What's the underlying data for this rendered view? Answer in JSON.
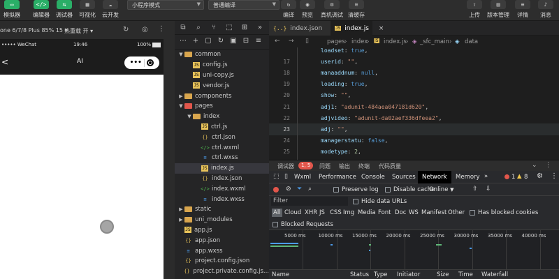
{
  "toolbar": {
    "buttons": [
      {
        "label": "模拟器",
        "glyph": "▭"
      },
      {
        "label": "编辑器",
        "glyph": "</>"
      },
      {
        "label": "调试器",
        "glyph": "⇆"
      },
      {
        "label": "可视化",
        "glyph": "▦"
      },
      {
        "label": "云开发",
        "glyph": "☁"
      }
    ],
    "mode_select": "小程序模式",
    "compile_select": "普通编译",
    "center_buttons": [
      "编译",
      "预览",
      "真机调试",
      "清缓存"
    ],
    "right_buttons": [
      "上传",
      "版本管理",
      "详情",
      "消息"
    ]
  },
  "simulator": {
    "device": "one 6/7/8 Plus 85% 15 ▾",
    "hotreload": "热重载 开 ▾",
    "status_carrier": "••••• WeChat",
    "status_time": "19:46",
    "status_battery": "100%",
    "nav_title": "AI",
    "nav_back": "<",
    "capsule_dots": "•••"
  },
  "explorer": {
    "items": [
      {
        "label": "common",
        "depth": 1,
        "type": "folder",
        "open": true,
        "color": "#d9a64e"
      },
      {
        "label": "config.js",
        "depth": 2,
        "type": "js"
      },
      {
        "label": "uni-copy.js",
        "depth": 2,
        "type": "js"
      },
      {
        "label": "vendor.js",
        "depth": 2,
        "type": "js"
      },
      {
        "label": "components",
        "depth": 1,
        "type": "folder",
        "open": false,
        "color": "#d9a64e"
      },
      {
        "label": "pages",
        "depth": 1,
        "type": "folder",
        "open": true,
        "color": "#e2564b"
      },
      {
        "label": "index",
        "depth": 2,
        "type": "folder",
        "open": true,
        "color": "#d9a64e"
      },
      {
        "label": "ctrl.js",
        "depth": 3,
        "type": "js"
      },
      {
        "label": "ctrl.json",
        "depth": 3,
        "type": "json"
      },
      {
        "label": "ctrl.wxml",
        "depth": 3,
        "type": "wxml"
      },
      {
        "label": "ctrl.wxss",
        "depth": 3,
        "type": "wxss"
      },
      {
        "label": "index.js",
        "depth": 3,
        "type": "js",
        "selected": true
      },
      {
        "label": "index.json",
        "depth": 3,
        "type": "json"
      },
      {
        "label": "index.wxml",
        "depth": 3,
        "type": "wxml"
      },
      {
        "label": "index.wxss",
        "depth": 3,
        "type": "wxss"
      },
      {
        "label": "static",
        "depth": 1,
        "type": "folder",
        "open": false,
        "color": "#d9a64e"
      },
      {
        "label": "uni_modules",
        "depth": 1,
        "type": "folder",
        "open": false,
        "color": "#d9a64e"
      },
      {
        "label": "app.js",
        "depth": 1,
        "type": "js"
      },
      {
        "label": "app.json",
        "depth": 1,
        "type": "json"
      },
      {
        "label": "app.wxss",
        "depth": 1,
        "type": "wxss"
      },
      {
        "label": "project.config.json",
        "depth": 1,
        "type": "json"
      },
      {
        "label": "project.private.config.js...",
        "depth": 1,
        "type": "json"
      }
    ]
  },
  "editor": {
    "tabs": [
      {
        "label": "index.json",
        "icon": "{..}",
        "active": false
      },
      {
        "label": "index.js",
        "icon": "JS",
        "active": true
      }
    ],
    "breadcrumb": [
      "pages",
      "index",
      "index.js",
      "_sfc_main",
      "data"
    ],
    "lines": [
      {
        "n": "",
        "key": "loadset",
        "val": "true",
        "kind": "kw"
      },
      {
        "n": "17",
        "key": "userid",
        "val": "\"\"",
        "kind": "str"
      },
      {
        "n": "18",
        "key": "manaaddnum",
        "val": "null",
        "kind": "kw"
      },
      {
        "n": "19",
        "key": "loading",
        "val": "true",
        "kind": "kw"
      },
      {
        "n": "20",
        "key": "show",
        "val": "\"\"",
        "kind": "str"
      },
      {
        "n": "21",
        "key": "adj1",
        "val": "\"adunit-484aea047181d620\"",
        "kind": "str"
      },
      {
        "n": "22",
        "key": "adjvideo",
        "val": "\"adunit-da02aef336dfeea2\"",
        "kind": "str"
      },
      {
        "n": "23",
        "key": "adj",
        "val": "\"\"",
        "kind": "str",
        "current": true
      },
      {
        "n": "24",
        "key": "managerstatu",
        "val": "false",
        "kind": "kw"
      },
      {
        "n": "25",
        "key": "modetype",
        "val": "2",
        "kind": "num"
      }
    ]
  },
  "devtools": {
    "header_tabs": [
      "调试器",
      "问题",
      "输出",
      "终端",
      "代码质量"
    ],
    "header_badge": "1, 5",
    "tabs": [
      "Wxml",
      "Performance",
      "Console",
      "Sources",
      "Network",
      "Memory",
      "»"
    ],
    "active_tab": "Network",
    "errors": "1",
    "warnings": "8",
    "preserve_log": "Preserve log",
    "disable_cache": "Disable cache",
    "throttle": "Online",
    "filter_placeholder": "Filter",
    "hide_data_urls": "Hide data URLs",
    "types": [
      "All",
      "Cloud",
      "XHR",
      "JS",
      "CSS",
      "Img",
      "Media",
      "Font",
      "Doc",
      "WS",
      "Manifest",
      "Other"
    ],
    "has_blocked_cookies": "Has blocked cookies",
    "blocked_requests": "Blocked Requests",
    "timeline_ticks": [
      "5000 ms",
      "10000 ms",
      "15000 ms",
      "20000 ms",
      "25000 ms",
      "30000 ms",
      "35000 ms",
      "40000 ms"
    ],
    "columns": [
      "Name",
      "Status",
      "Type",
      "Initiator",
      "Size",
      "Time",
      "Waterfall"
    ]
  },
  "colors": {
    "accent_green": "#2aae67",
    "error_red": "#e2564b",
    "warning_yellow": "#f2c94c"
  }
}
